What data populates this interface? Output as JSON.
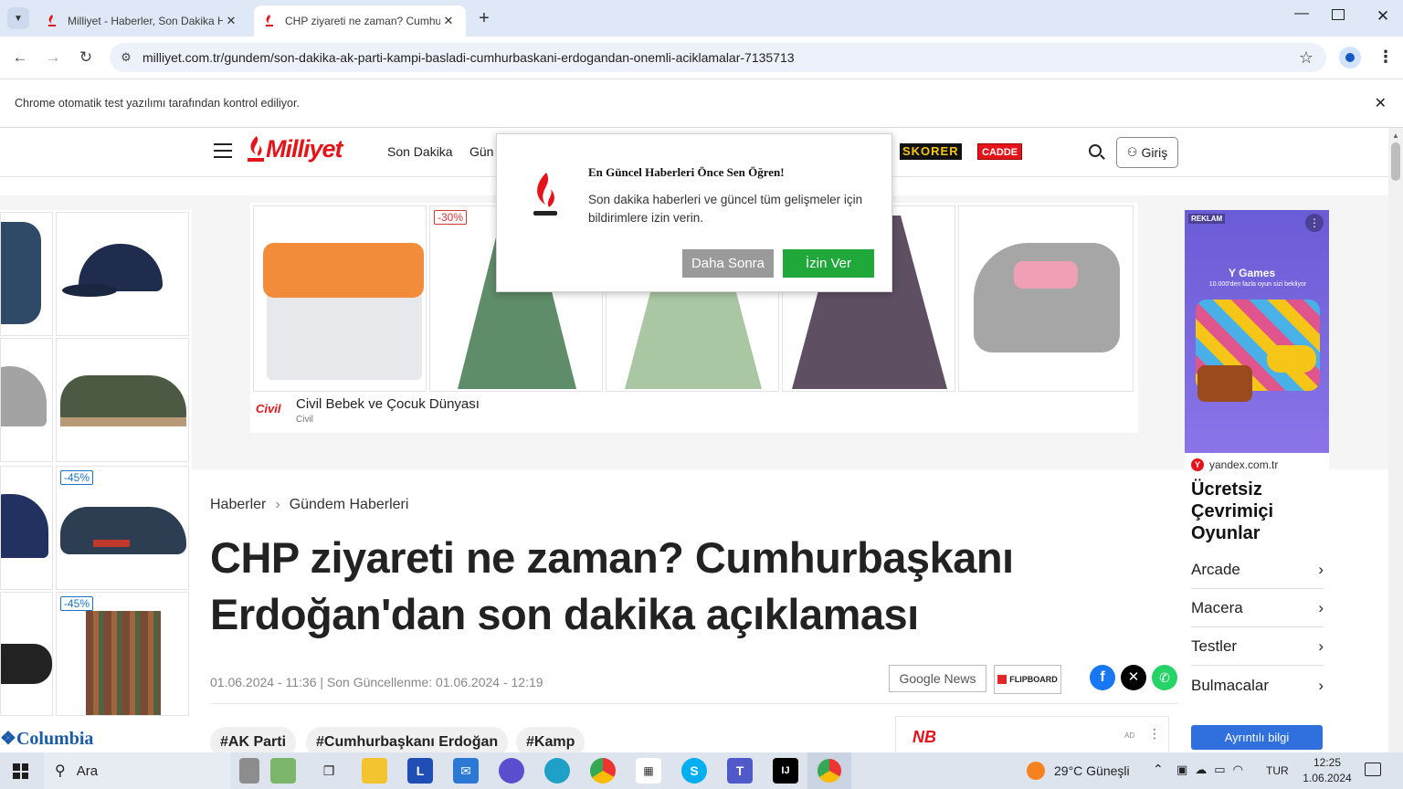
{
  "browser": {
    "tabs": [
      {
        "title": "Milliyet - Haberler, Son Dakika Haberleri ve Güncel Haberler"
      },
      {
        "title": "CHP ziyareti ne zaman? Cumhurbaşkanı Erdoğan'dan son dakika açıklaması"
      }
    ],
    "url": "milliyet.com.tr/gundem/son-dakika-ak-parti-kampi-basladi-cumhurbaskani-erdogandan-onemli-aciklamalar-7135713",
    "infobar": "Chrome otomatik test yazılımı tarafından kontrol ediliyor."
  },
  "site": {
    "logo": "Milliyet",
    "nav": [
      "Son Dakika",
      "Gün"
    ],
    "brands": [
      "SKORER",
      "CADDE"
    ],
    "login": "Giriş"
  },
  "ads": {
    "left_brand": "Columbia",
    "left_badges": [
      "-45%",
      "-45%"
    ],
    "center_badge": "-30%",
    "center_advertiser": "Civil Bebek ve Çocuk Dünyası",
    "center_domain": "Civil",
    "center_logo": "Civil",
    "right": {
      "label": "REKLAM",
      "game_brand": "Y Games",
      "game_sub": "10.000'den fazla oyun sizi bekliyor",
      "domain": "yandex.com.tr",
      "headline": "Ücretsiz Çevrimiçi Oyunlar",
      "items": [
        "Arcade",
        "Macera",
        "Testler",
        "Bulmacalar"
      ],
      "cta": "Ayrıntılı bilgi"
    },
    "bottom_label": "AD"
  },
  "popup": {
    "title": "En Güncel Haberleri Önce Sen Öğren!",
    "text": "Son dakika haberleri ve güncel tüm gelişmeler için bildirimlere izin verin.",
    "later": "Daha Sonra",
    "allow": "İzin Ver"
  },
  "article": {
    "breadcrumb": [
      "Haberler",
      "Gündem Haberleri"
    ],
    "title": "CHP ziyareti ne zaman? Cumhurbaşkanı Erdoğan'dan son dakika açıklaması",
    "meta": "01.06.2024 - 11:36 | Son Güncellenme: 01.06.2024 - 12:19",
    "google_news": "Google News",
    "flipboard": "FLIPBOARD",
    "tags": [
      "#AK Parti",
      "#Cumhurbaşkanı Erdoğan",
      "#Kamp"
    ]
  },
  "taskbar": {
    "search": "Ara",
    "weather": "29°C  Güneşli",
    "lang": "TUR",
    "time": "12:25",
    "date": "1.06.2024"
  }
}
